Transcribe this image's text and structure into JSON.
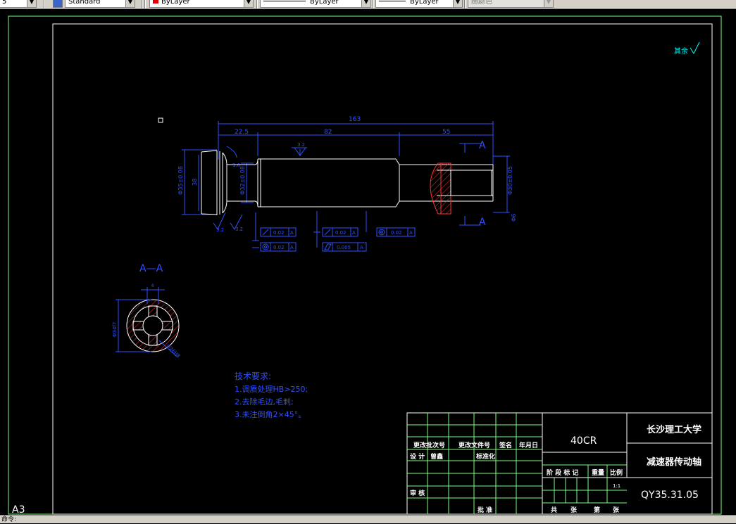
{
  "toolbar": {
    "scale_fragment": "5",
    "textstyle": "Standard",
    "layer": "ByLayer",
    "linetype": "ByLayer",
    "lineweight": "ByLayer",
    "plotstyle": "随颜色",
    "colors": {
      "layer_swatch": "#e00000"
    }
  },
  "drawing": {
    "surface_roughness_note": "其余",
    "dimensions": {
      "overall_length": "163",
      "seg1": "22.5",
      "seg2": "82",
      "seg3": "55",
      "left_dia_tol": "Φ35±0.08",
      "left_dia": "38",
      "mid_dia": "Φ32±0.08",
      "right_dia": "Φ30±0.05",
      "right_phi": "Φ6",
      "rough_top": "3.2",
      "rough_left1": "3.2",
      "rough_left2": "3.2",
      "rough_right": "1.6",
      "gdt_tolerances": [
        "0.02",
        "0.02",
        "0.02",
        "0.005",
        "0.02"
      ],
      "gdt_datum": "A"
    },
    "section": {
      "title": "A—A",
      "label_a": "A",
      "dim_left": "Φ34f7",
      "dim_top": "6",
      "dim_right": "Φ26H8"
    },
    "tech": {
      "title": "技术要求:",
      "lines": [
        "1.调质处理HB>250;",
        "2.去除毛边,毛刺;",
        "3.未注倒角2×45°。"
      ]
    },
    "titleblock": {
      "material": "40CR",
      "school": "长沙理工大学",
      "part_name": "减速器传动轴",
      "drawing_no": "QY35.31.05",
      "scale_value": "1:1",
      "headers": [
        "更改批次号",
        "更改文件号",
        "签名",
        "年月日"
      ],
      "row_design": [
        "设 计",
        "曾鑫",
        "标准化"
      ],
      "row_stage": [
        "阶 段 标 记",
        "重量",
        "比例"
      ],
      "row_review": "审 核",
      "row_bottom": [
        "批 准",
        "共",
        "张",
        "第",
        "张"
      ]
    },
    "sheet_size": "A3"
  },
  "cmdline": {
    "text": "命令:"
  }
}
